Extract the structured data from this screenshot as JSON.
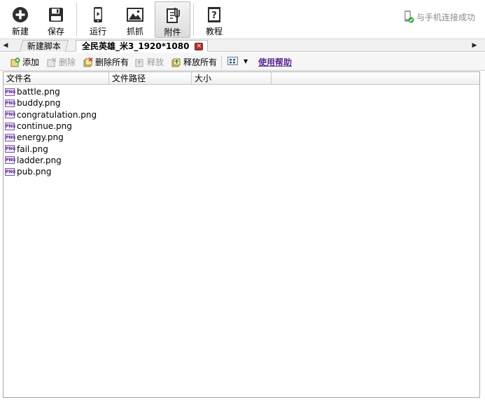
{
  "toolbar": {
    "buttons": [
      {
        "label": "新建",
        "icon": "plus-circle-icon"
      },
      {
        "label": "保存",
        "icon": "floppy-disk-icon"
      },
      {
        "label": "运行",
        "icon": "phone-play-icon"
      },
      {
        "label": "抓抓",
        "icon": "image-capture-icon"
      },
      {
        "label": "附件",
        "icon": "paperclip-doc-icon"
      },
      {
        "label": "教程",
        "icon": "help-book-icon"
      }
    ],
    "active": "附件",
    "connection_status": "与手机连接成功"
  },
  "tabs": [
    {
      "label": "新建脚本",
      "active": false
    },
    {
      "label": "全民英雄_米3_1920*1080",
      "active": true
    }
  ],
  "subtoolbar": {
    "add": "添加",
    "delete": "删除",
    "delete_all": "删除所有",
    "release": "释放",
    "release_all": "释放所有",
    "help": "使用帮助"
  },
  "list": {
    "columns": [
      "文件名",
      "文件路径",
      "大小"
    ],
    "file_icon_text": "PNG",
    "rows": [
      {
        "name": "battle.png"
      },
      {
        "name": "buddy.png"
      },
      {
        "name": "congratulation.png"
      },
      {
        "name": "continue.png"
      },
      {
        "name": "energy.png"
      },
      {
        "name": "fail.png"
      },
      {
        "name": "ladder.png"
      },
      {
        "name": "pub.png"
      }
    ]
  },
  "colors": {
    "help_link": "#5a2a90",
    "disabled_text": "#9a9a9a",
    "status_text": "#8a8a8a",
    "tab_close": "#b03030"
  }
}
